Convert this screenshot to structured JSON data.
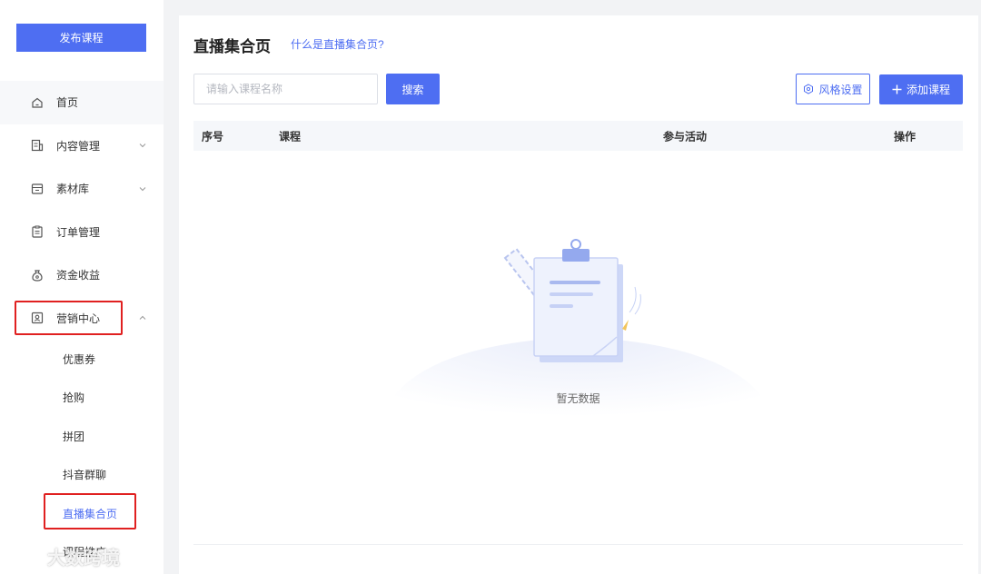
{
  "sidebar": {
    "publish_button": "发布课程",
    "items": [
      {
        "label": "首页",
        "icon": "home-icon"
      },
      {
        "label": "内容管理",
        "icon": "content-icon",
        "chevron": "chevron-down-icon"
      },
      {
        "label": "素材库",
        "icon": "folder-icon",
        "chevron": "chevron-down-icon"
      },
      {
        "label": "订单管理",
        "icon": "order-icon"
      },
      {
        "label": "资金收益",
        "icon": "money-bag-icon"
      },
      {
        "label": "营销中心",
        "icon": "marketing-icon",
        "chevron": "chevron-up-icon"
      }
    ],
    "submenu": [
      "优惠券",
      "抢购",
      "拼团",
      "抖音群聊",
      "直播集合页",
      "课程推广"
    ]
  },
  "main": {
    "title": "直播集合页",
    "help_link": "什么是直播集合页?",
    "search": {
      "placeholder": "请输入课程名称",
      "button": "搜索"
    },
    "style_button": "风格设置",
    "add_button": "添加课程",
    "table": {
      "columns": [
        "序号",
        "课程",
        "参与活动",
        "操作"
      ]
    },
    "empty_text": "暂无数据"
  },
  "watermark": "大数跨境",
  "colors": {
    "accent": "#4e6ef2",
    "highlight_box": "#e02020"
  }
}
